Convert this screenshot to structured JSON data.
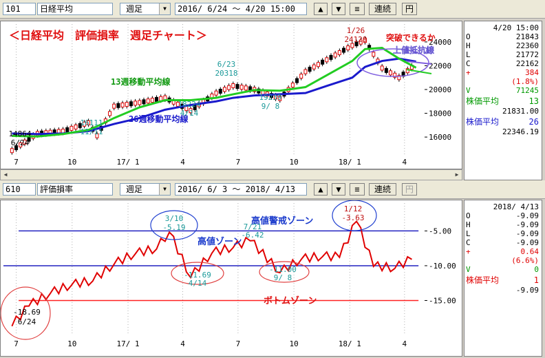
{
  "top": {
    "code": "101",
    "name": "日経平均",
    "period": "週足",
    "range": "2016/ 6/24 ～  4/20 15:00",
    "btn_up": "▲",
    "btn_down": "▼",
    "btn_menu": "≡",
    "btn_continuous": "連続",
    "btn_yen": "円"
  },
  "top_chart": {
    "title": "＜日経平均　評価損率　週足チャート＞",
    "annot_break": "突破できるか",
    "annot_resistance": "上値抵抗線",
    "label_ma13": "13週移動平均線",
    "label_ma26": "26週移動平均線",
    "x_ticks": [
      "7",
      "10",
      "17/ 1",
      "4",
      "7",
      "10",
      "18/ 1",
      "4"
    ],
    "y_ticks": [
      "24000",
      "22000",
      "20000",
      "18000",
      "16000"
    ],
    "points": [
      {
        "label": "1/26",
        "value": "24129"
      },
      {
        "label": "6/23",
        "value": "20318"
      },
      {
        "label": "18224",
        "value": "4/14"
      },
      {
        "label": "19239",
        "value": "9/ 8"
      },
      {
        "label": "16111",
        "value": "11/11"
      },
      {
        "label": "14864",
        "value": "6/24"
      }
    ]
  },
  "top_side": {
    "time": "4/20 15:00",
    "o_k": "O",
    "o_v": "21843",
    "h_k": "H",
    "h_v": "22360",
    "l_k": "L",
    "l_v": "21772",
    "c_k": "C",
    "c_v": "22162",
    "chg_k": "+",
    "chg_v": "384",
    "pct_v": "(1.8%)",
    "vol_k": "V",
    "vol_v": "71245",
    "ma13_label": "株価平均",
    "ma13_n": "13",
    "ma13_v": "21831.00",
    "ma26_label": "株価平均",
    "ma26_n": "26",
    "ma26_v": "22346.19"
  },
  "bottom": {
    "code": "610",
    "name": "評価損率",
    "period": "週足",
    "range": "2016/ 6/ 3 ～  2018/ 4/13",
    "btn_up": "▲",
    "btn_down": "▼",
    "btn_menu": "≡",
    "btn_continuous": "連続",
    "btn_yen": "円"
  },
  "bottom_chart": {
    "zone_high_alert": "高値警戒ゾーン",
    "zone_high": "高値ゾーン",
    "zone_bottom": "ボトムゾーン",
    "x_ticks": [
      "7",
      "10",
      "17/ 1",
      "4",
      "7",
      "10",
      "18/ 1",
      "4"
    ],
    "y_ticks": [
      "-5.00",
      "-10.00",
      "-15.00"
    ],
    "points": [
      {
        "label": "3/10",
        "value": "-5.19"
      },
      {
        "label": "7/21",
        "value": "-6.42"
      },
      {
        "label": "1/12",
        "value": "-3.63"
      },
      {
        "label": "-11.69",
        "value": "4/14"
      },
      {
        "label": "-11.00",
        "value": "9/ 8"
      },
      {
        "label": "-18.69",
        "value": "6/24"
      }
    ]
  },
  "bottom_side": {
    "date": "2018/ 4/13",
    "o_k": "O",
    "o_v": "-9.09",
    "h_k": "H",
    "h_v": "-9.09",
    "l_k": "L",
    "l_v": "-9.09",
    "c_k": "C",
    "c_v": "-9.09",
    "chg_k": "+",
    "chg_v": "0.64",
    "pct_v": "(6.6%)",
    "vol_k": "V",
    "vol_v": "0",
    "ma_label": "株価平均",
    "ma_n": "1",
    "ma_v": "-9.09"
  },
  "colors": {
    "ma13": "#22cc22",
    "ma26": "#1a1acc",
    "price": "#e00000",
    "alert_line": "#2020c0",
    "bottom_line": "#ff2020",
    "annotation_red": "#e01010",
    "cyan_label": "#1a9999"
  },
  "chart_data": [
    {
      "type": "line",
      "title": "＜日経平均　評価損率　週足チャート＞",
      "x": [
        "2016-06-24",
        "2016-08-05",
        "2016-09-16",
        "2016-10-28",
        "2016-11-11",
        "2016-12-09",
        "2017-01-20",
        "2017-03-03",
        "2017-04-14",
        "2017-05-26",
        "2017-06-23",
        "2017-07-28",
        "2017-09-08",
        "2017-10-20",
        "2017-11-24",
        "2018-01-05",
        "2018-01-26",
        "2018-02-23",
        "2018-03-23",
        "2018-04-20"
      ],
      "series": [
        {
          "name": "日経平均",
          "values": [
            14864,
            16300,
            16500,
            17200,
            16111,
            18600,
            18900,
            19300,
            18224,
            19700,
            20318,
            20000,
            19239,
            21500,
            22500,
            23700,
            24129,
            21800,
            21000,
            22162
          ]
        },
        {
          "name": "13週移動平均線",
          "values": [
            16100,
            16050,
            16250,
            16600,
            16900,
            17600,
            18500,
            19100,
            19100,
            19300,
            19600,
            19950,
            19900,
            20200,
            21200,
            22400,
            23400,
            23500,
            22600,
            21831
          ]
        },
        {
          "name": "26週移動平均線",
          "values": [
            16300,
            16250,
            16300,
            16500,
            16700,
            17100,
            17600,
            18300,
            18700,
            19000,
            19300,
            19500,
            19600,
            19700,
            20300,
            21000,
            21900,
            22400,
            22600,
            22346
          ]
        }
      ],
      "ylim": [
        14500,
        25500
      ],
      "y_ticks": [
        16000,
        18000,
        20000,
        22000,
        24000
      ]
    },
    {
      "type": "line",
      "x": [
        "2016-06-24",
        "2016-07-22",
        "2016-08-26",
        "2016-09-30",
        "2016-11-04",
        "2016-12-09",
        "2017-01-13",
        "2017-02-17",
        "2017-03-10",
        "2017-04-14",
        "2017-05-19",
        "2017-06-23",
        "2017-07-21",
        "2017-09-08",
        "2017-10-13",
        "2017-11-17",
        "2017-12-15",
        "2018-01-12",
        "2018-02-09",
        "2018-03-16",
        "2018-04-13"
      ],
      "series": [
        {
          "name": "評価損率",
          "values": [
            -18.69,
            -15.8,
            -14.0,
            -12.8,
            -12.2,
            -9.8,
            -8.3,
            -7.6,
            -5.19,
            -11.69,
            -8.2,
            -7.4,
            -6.42,
            -11.0,
            -9.1,
            -8.7,
            -8.8,
            -3.63,
            -10.1,
            -10.4,
            -9.09
          ]
        }
      ],
      "ylim": [
        -20,
        -1
      ],
      "y_ticks": [
        -5,
        -10,
        -15
      ],
      "reference_lines": [
        -5.0,
        -10.0,
        -15.0
      ]
    }
  ]
}
